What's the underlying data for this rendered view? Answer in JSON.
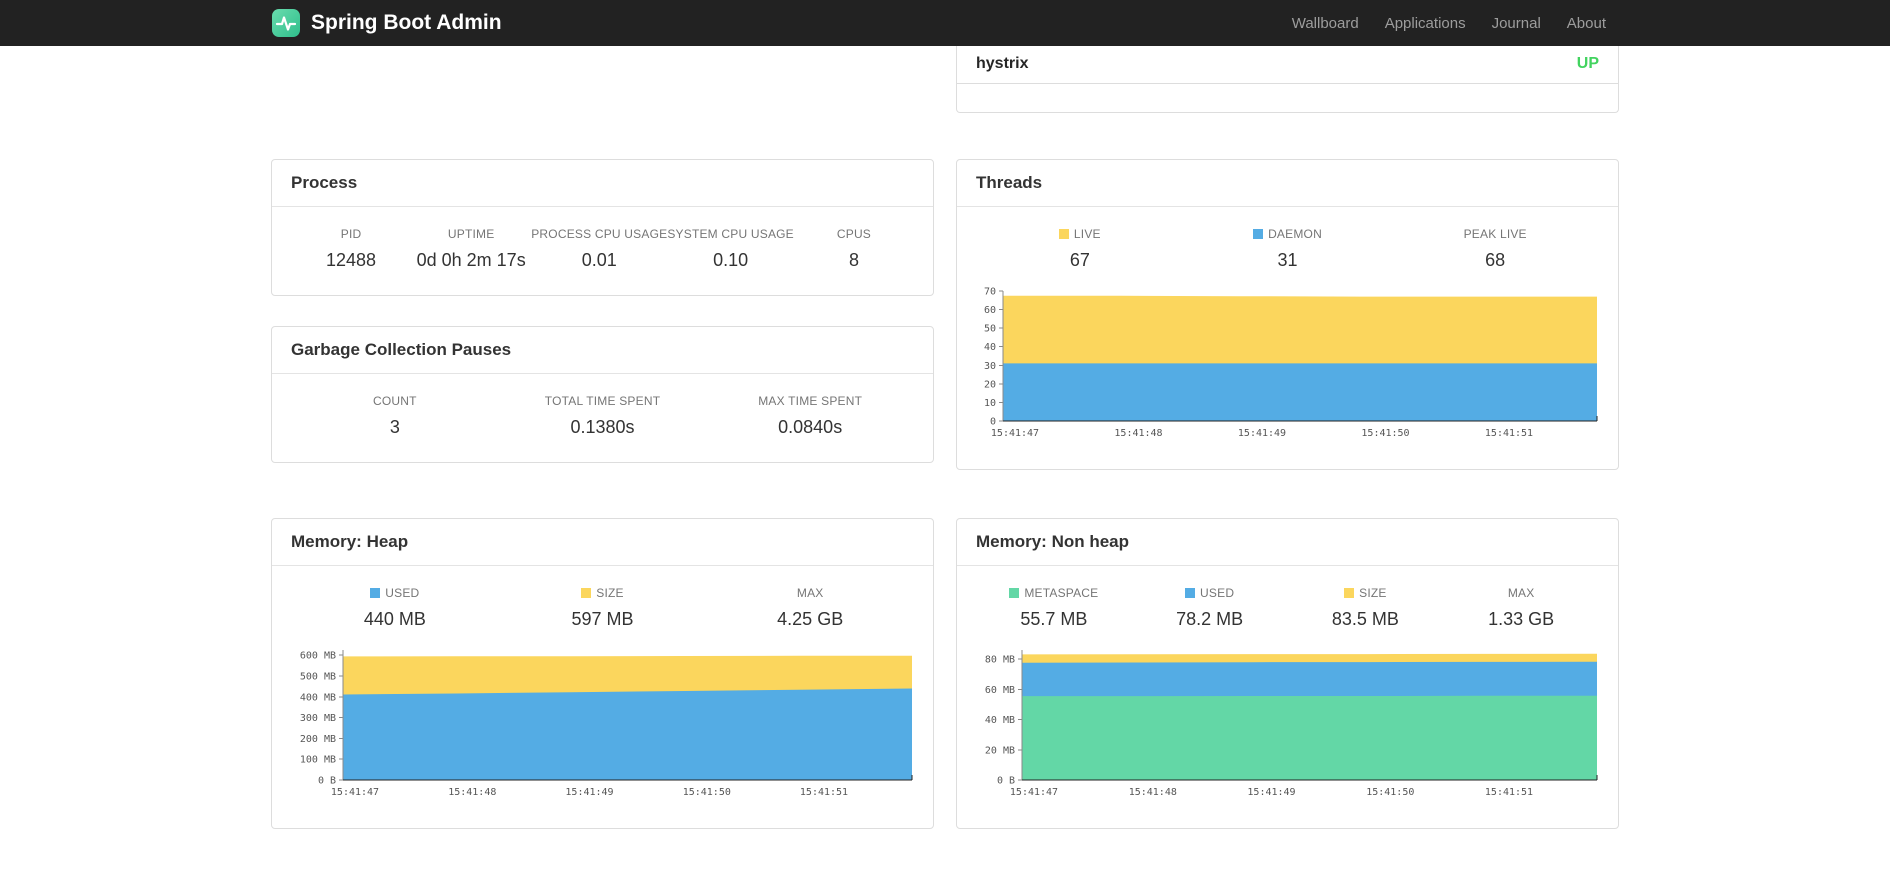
{
  "navbar": {
    "brand": "Spring Boot Admin",
    "links": [
      {
        "label": "Wallboard"
      },
      {
        "label": "Applications"
      },
      {
        "label": "Journal"
      },
      {
        "label": "About"
      }
    ]
  },
  "colors": {
    "navbar_bg": "#222222",
    "brand_teal": "#40C98E",
    "accent_yellow": "#FBD65D",
    "accent_blue": "#54ACE4",
    "accent_green": "#63D7A6",
    "status_up": "#42D35F"
  },
  "status_panel": {
    "service": "hystrix",
    "status": "UP",
    "status_color": "#42D35F"
  },
  "process_panel": {
    "title": "Process",
    "metrics": [
      {
        "label": "PID",
        "value": "12488"
      },
      {
        "label": "UPTIME",
        "value": "0d 0h 2m 17s"
      },
      {
        "label": "PROCESS CPU USAGE",
        "value": "0.01"
      },
      {
        "label": "SYSTEM CPU USAGE",
        "value": "0.10"
      },
      {
        "label": "CPUS",
        "value": "8"
      }
    ]
  },
  "gc_panel": {
    "title": "Garbage Collection Pauses",
    "metrics": [
      {
        "label": "COUNT",
        "value": "3"
      },
      {
        "label": "TOTAL TIME SPENT",
        "value": "0.1380s"
      },
      {
        "label": "MAX TIME SPENT",
        "value": "0.0840s"
      }
    ]
  },
  "threads_panel": {
    "title": "Threads",
    "legend": [
      {
        "label": "LIVE",
        "value": "67",
        "swatch": "#FBD65D"
      },
      {
        "label": "DAEMON",
        "value": "31",
        "swatch": "#54ACE4"
      },
      {
        "label": "PEAK LIVE",
        "value": "68",
        "swatch": null
      }
    ]
  },
  "heap_panel": {
    "title": "Memory: Heap",
    "legend": [
      {
        "label": "USED",
        "value": "440 MB",
        "swatch": "#54ACE4"
      },
      {
        "label": "SIZE",
        "value": "597 MB",
        "swatch": "#FBD65D"
      },
      {
        "label": "MAX",
        "value": "4.25 GB",
        "swatch": null
      }
    ]
  },
  "nonheap_panel": {
    "title": "Memory: Non heap",
    "legend": [
      {
        "label": "METASPACE",
        "value": "55.7 MB",
        "swatch": "#63D7A6"
      },
      {
        "label": "USED",
        "value": "78.2 MB",
        "swatch": "#54ACE4"
      },
      {
        "label": "SIZE",
        "value": "83.5 MB",
        "swatch": "#FBD65D"
      },
      {
        "label": "MAX",
        "value": "1.33 GB",
        "swatch": null
      }
    ]
  },
  "chart_data": [
    {
      "id": "threads",
      "type": "area",
      "title": "Threads",
      "stacking": "overlay-front-to-back",
      "x": [
        "15:41:47",
        "15:41:48",
        "15:41:49",
        "15:41:50",
        "15:41:51"
      ],
      "ymax": 70,
      "yticks": [
        {
          "v": 0,
          "label": "0"
        },
        {
          "v": 10,
          "label": "10"
        },
        {
          "v": 20,
          "label": "20"
        },
        {
          "v": 30,
          "label": "30"
        },
        {
          "v": 40,
          "label": "40"
        },
        {
          "v": 50,
          "label": "50"
        },
        {
          "v": 60,
          "label": "60"
        },
        {
          "v": 70,
          "label": "70"
        }
      ],
      "series": [
        {
          "name": "LIVE",
          "color": "#FBD65D",
          "values": [
            67.4,
            67.4,
            67.2,
            67,
            67,
            67
          ]
        },
        {
          "name": "DAEMON",
          "color": "#54ACE4",
          "values": [
            31,
            31,
            31,
            31,
            31,
            31
          ]
        }
      ]
    },
    {
      "id": "heap",
      "type": "area",
      "title": "Memory: Heap",
      "stacking": "overlay-front-to-back",
      "x": [
        "15:41:47",
        "15:41:48",
        "15:41:49",
        "15:41:50",
        "15:41:51"
      ],
      "ymax": 625,
      "yticks": [
        {
          "v": 0,
          "label": "0 B"
        },
        {
          "v": 100,
          "label": "100 MB"
        },
        {
          "v": 200,
          "label": "200 MB"
        },
        {
          "v": 300,
          "label": "300 MB"
        },
        {
          "v": 400,
          "label": "400 MB"
        },
        {
          "v": 500,
          "label": "500 MB"
        },
        {
          "v": 600,
          "label": "600 MB"
        }
      ],
      "series": [
        {
          "name": "SIZE",
          "color": "#FBD65D",
          "values": [
            594,
            595,
            595,
            596,
            597,
            597
          ]
        },
        {
          "name": "USED",
          "color": "#54ACE4",
          "values": [
            411,
            416,
            422,
            428,
            434,
            440
          ]
        }
      ]
    },
    {
      "id": "nonheap",
      "type": "area",
      "title": "Memory: Non heap",
      "stacking": "overlay-front-to-back",
      "x": [
        "15:41:47",
        "15:41:48",
        "15:41:49",
        "15:41:50",
        "15:41:51"
      ],
      "ymax": 86,
      "yticks": [
        {
          "v": 0,
          "label": "0 B"
        },
        {
          "v": 20,
          "label": "20 MB"
        },
        {
          "v": 40,
          "label": "40 MB"
        },
        {
          "v": 60,
          "label": "60 MB"
        },
        {
          "v": 80,
          "label": "80 MB"
        }
      ],
      "series": [
        {
          "name": "SIZE",
          "color": "#FBD65D",
          "values": [
            83.1,
            83.2,
            83.3,
            83.3,
            83.4,
            83.5
          ]
        },
        {
          "name": "USED",
          "color": "#54ACE4",
          "values": [
            77.6,
            77.7,
            77.9,
            78.0,
            78.1,
            78.2
          ]
        },
        {
          "name": "METASPACE",
          "color": "#63D7A6",
          "values": [
            55.5,
            55.5,
            55.6,
            55.6,
            55.7,
            55.7
          ]
        }
      ]
    }
  ]
}
